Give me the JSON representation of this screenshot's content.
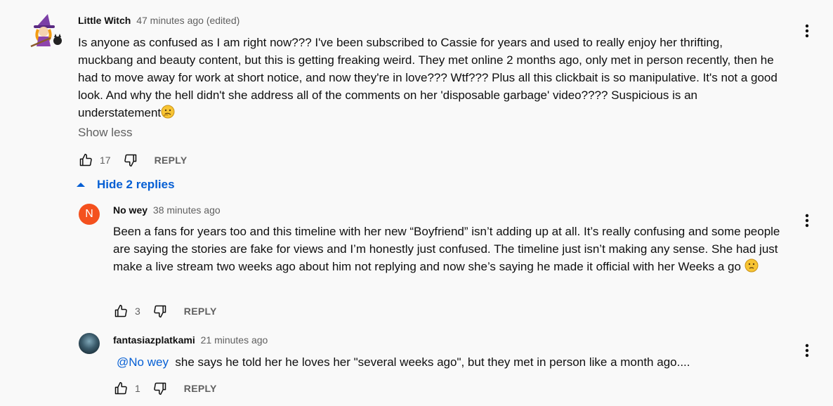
{
  "comments": [
    {
      "author": "Little Witch",
      "time": "47 minutes ago (edited)",
      "text": "Is anyone as confused as I am right now??? I've been subscribed to Cassie for years and used to really enjoy her thrifting, muckbang and beauty content, but this is getting freaking weird. They met online 2 months ago, only met in person recently, then he had to move away for work at short notice, and now they're in love??? Wtf??? Plus all this clickbait is so manipulative. It's not a good look. And why the hell didn't she address all of the comments on her 'disposable garbage' video???? Suspicious is an understatement",
      "emoji": "thinking-face",
      "show_less": "Show less",
      "likes": "17",
      "reply_label": "REPLY"
    }
  ],
  "replies_toggle": {
    "label": "Hide 2 replies"
  },
  "replies": [
    {
      "avatar_letter": "N",
      "avatar_color": "#f4511e",
      "author": "No wey",
      "time": "38 minutes ago",
      "text": "Been a fans for years too and this timeline with her new “Boyfriend” isn’t adding up at all. It’s really confusing and some people are saying the stories are fake for views and I’m honestly just confused. The timeline just isn’t making any sense. She had just make a live stream two weeks ago about him not replying and now she’s saying he made it official with her Weeks a go",
      "emoji": "confused-face",
      "likes": "3",
      "reply_label": "REPLY"
    },
    {
      "author": "fantasiazplatkami",
      "time": "21 minutes ago",
      "mention": "@No wey",
      "text": "she says he told her he loves her \"several weeks ago\", but they met in person like a month ago....",
      "likes": "1",
      "reply_label": "REPLY"
    }
  ],
  "colors": {
    "link": "#065fd4",
    "meta": "#606060",
    "background": "#f9f9f9"
  }
}
